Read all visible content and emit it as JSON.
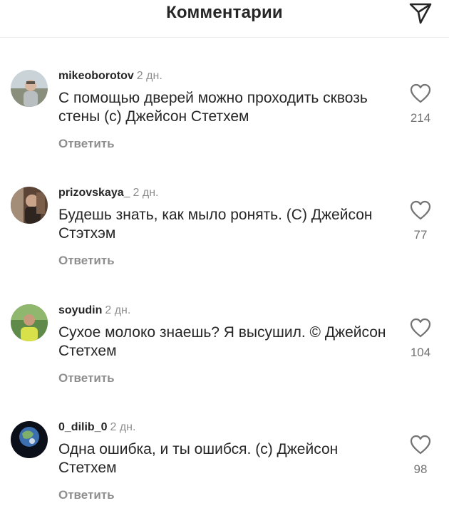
{
  "header": {
    "title": "Комментарии"
  },
  "icons": {
    "send": "paper-plane-icon",
    "like": "heart-outline-icon"
  },
  "colors": {
    "text": "#262626",
    "muted": "#8e8e8e"
  },
  "comments": [
    {
      "username": "mikeoborotov",
      "time": "2 дн.",
      "text": "С помощью дверей можно проходить сквозь стены (с) Джейсон Стетхем",
      "reply_label": "Ответить",
      "likes": "214"
    },
    {
      "username": "prizovskaya_",
      "time": "2 дн.",
      "text": "Будешь знать, как мыло ронять. (С) Джейсон Стэтхэм",
      "reply_label": "Ответить",
      "likes": "77"
    },
    {
      "username": "soyudin",
      "time": "2 дн.",
      "text": "Сухое молоко знаешь? Я высушил. © Джейсон Стетхем",
      "reply_label": "Ответить",
      "likes": "104"
    },
    {
      "username": "0_dilib_0",
      "time": "2 дн.",
      "text": "Одна ошибка, и ты ошибся. (с) Джейсон Стетхем",
      "reply_label": "Ответить",
      "likes": "98"
    }
  ]
}
